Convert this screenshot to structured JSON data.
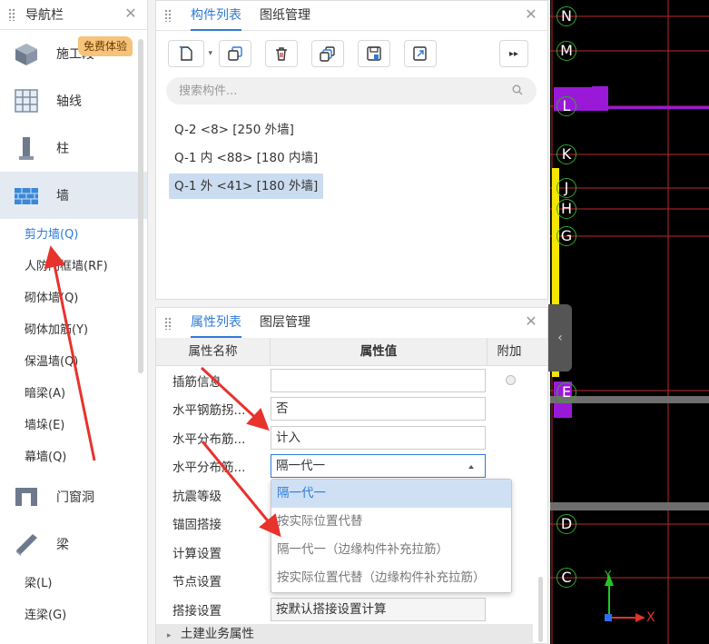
{
  "nav": {
    "title": "导航栏",
    "badge": "免费体验",
    "categories": [
      {
        "label": "施工段",
        "icon": "cube-icon"
      },
      {
        "label": "轴线",
        "icon": "grid-icon"
      },
      {
        "label": "柱",
        "icon": "column-icon"
      },
      {
        "label": "墙",
        "icon": "brick-wall-icon"
      }
    ],
    "wall_items": [
      "剪力墙(Q)",
      "人防门框墙(RF)",
      "砌体墙(Q)",
      "砌体加筋(Y)",
      "保温墙(Q)",
      "暗梁(A)",
      "墙垛(E)",
      "幕墙(Q)"
    ],
    "categories2": [
      {
        "label": "门窗洞",
        "icon": "door-window-icon"
      },
      {
        "label": "梁",
        "icon": "beam-icon"
      }
    ],
    "beam_items": [
      "梁(L)",
      "连梁(G)"
    ]
  },
  "components": {
    "tabs": [
      "构件列表",
      "图纸管理"
    ],
    "search_placeholder": "搜索构件...",
    "items": [
      "Q-2 <8> [250 外墙]",
      "Q-1 内 <88> [180 内墙]",
      "Q-1 外 <41> [180 外墙]"
    ]
  },
  "properties": {
    "tabs": [
      "属性列表",
      "图层管理"
    ],
    "headers": {
      "name": "属性名称",
      "value": "属性值",
      "aux": "附加"
    },
    "rows": [
      {
        "name": "插筋信息",
        "value": ""
      },
      {
        "name": "水平钢筋拐...",
        "value": "否"
      },
      {
        "name": "水平分布筋...",
        "value": "计入"
      },
      {
        "name": "水平分布筋...",
        "value": "隔一代一"
      },
      {
        "name": "抗震等级",
        "value": ""
      },
      {
        "name": "锚固搭接",
        "value": ""
      },
      {
        "name": "计算设置",
        "value": ""
      },
      {
        "name": "节点设置",
        "value": ""
      },
      {
        "name": "搭接设置",
        "value": "按默认搭接设置计算"
      }
    ],
    "group": "土建业务属性",
    "dropdown_options": [
      "隔一代一",
      "按实际位置代替",
      "隔一代一（边缘构件补充拉筋）",
      "按实际位置代替（边缘构件补充拉筋）"
    ]
  },
  "cad": {
    "axis_labels": [
      "N",
      "M",
      "L",
      "K",
      "J",
      "H",
      "G",
      "E",
      "D",
      "C"
    ],
    "x_label": "X",
    "y_label": "Y",
    "colors": {
      "axis_circle": "#2faa2f",
      "grid_line": "#c0282d",
      "wall": "#9a19d9",
      "highlight": "#f5e500"
    }
  },
  "colors": {
    "accent": "#2d7bd8",
    "annotation_arrow": "#e8322c"
  }
}
